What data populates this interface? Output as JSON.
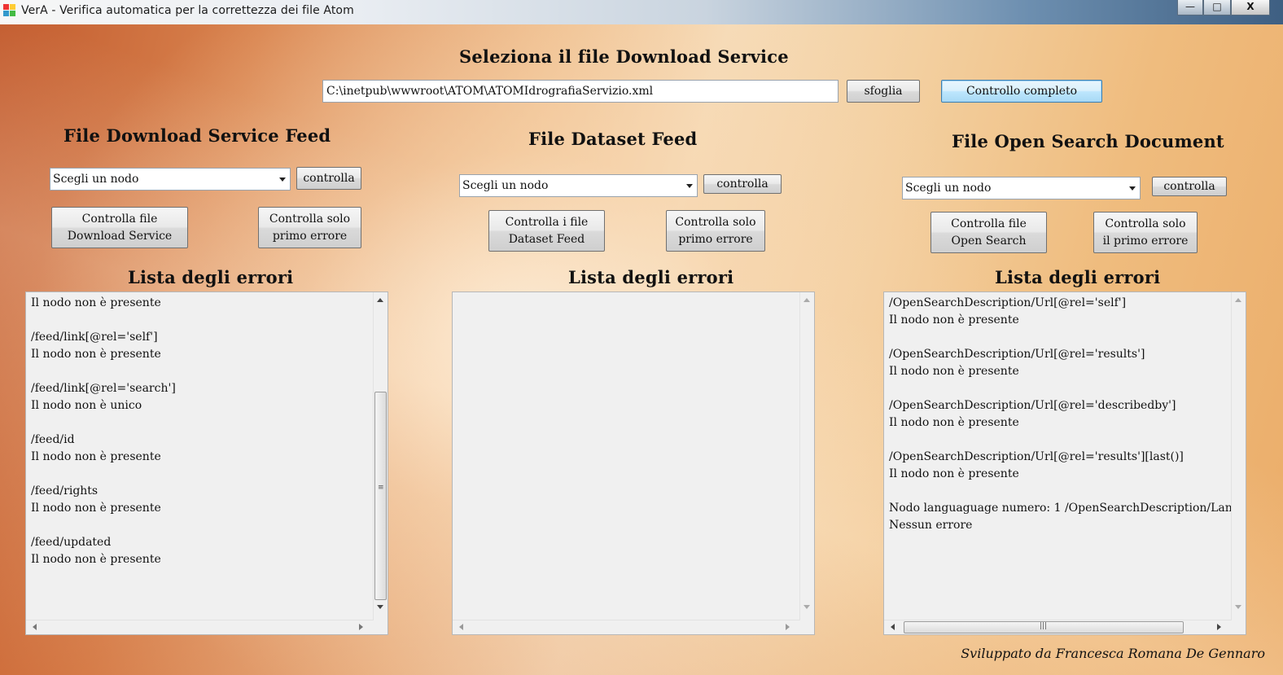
{
  "window": {
    "title": "VerA - Verifica automatica per la correttezza dei file Atom",
    "buttons": {
      "minimize": "—",
      "maximize": "□",
      "close": "X"
    }
  },
  "top": {
    "heading": "Seleziona il file Download Service",
    "path_value": "C:\\inetpub\\wwwroot\\ATOM\\ATOMIdrografiaServizio.xml",
    "browse_label": "sfoglia",
    "full_check_label": "Controllo completo"
  },
  "panels": [
    {
      "title": "File Download Service Feed",
      "combo_value": "Scegli un nodo",
      "check_label": "controlla",
      "btn_check_file": [
        "Controlla file",
        "Download Service"
      ],
      "btn_first_error": [
        "Controlla solo",
        "primo errore"
      ],
      "errors_title": "Lista degli errori",
      "errors": [
        "Il nodo non è presente",
        "",
        "/feed/link[@rel='self']",
        "Il nodo non è presente",
        "",
        "/feed/link[@rel='search']",
        "Il nodo non è unico",
        "",
        "/feed/id",
        "Il nodo non è presente",
        "",
        "/feed/rights",
        "Il nodo non è presente",
        "",
        "/feed/updated",
        "Il nodo non è presente"
      ]
    },
    {
      "title": "File Dataset Feed",
      "combo_value": "Scegli un nodo",
      "check_label": "controlla",
      "btn_check_file": [
        "Controlla i file",
        "Dataset Feed"
      ],
      "btn_first_error": [
        "Controlla solo",
        "primo errore"
      ],
      "errors_title": "Lista degli errori",
      "errors": []
    },
    {
      "title": "File Open Search Document",
      "combo_value": "Scegli un nodo",
      "check_label": "controlla",
      "btn_check_file": [
        "Controlla file",
        "Open Search"
      ],
      "btn_first_error": [
        "Controlla solo",
        "il primo errore"
      ],
      "errors_title": "Lista degli errori",
      "errors": [
        "/OpenSearchDescription/Url[@rel='self']",
        "Il nodo non è presente",
        "",
        "/OpenSearchDescription/Url[@rel='results']",
        "Il nodo non è presente",
        "",
        "/OpenSearchDescription/Url[@rel='describedby']",
        "Il nodo non è presente",
        "",
        "/OpenSearchDescription/Url[@rel='results'][last()]",
        "Il nodo non è presente",
        "",
        "Nodo languaguage numero: 1 /OpenSearchDescription/Lan",
        "Nessun errore"
      ]
    }
  ],
  "footer": "Sviluppato da Francesca Romana De Gennaro"
}
